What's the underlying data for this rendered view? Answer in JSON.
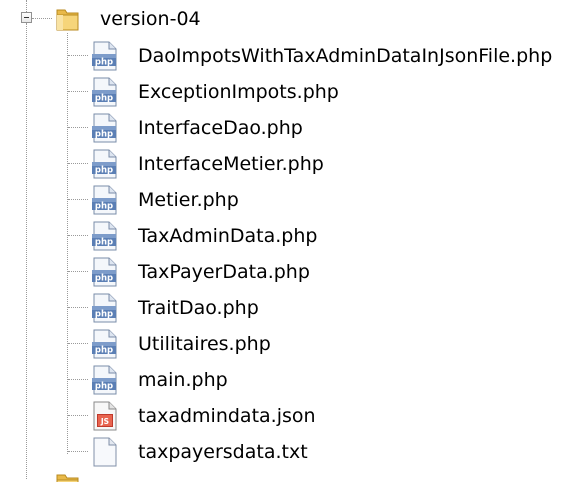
{
  "folder": {
    "name": "version-04",
    "icon": "folder-icon",
    "expanded": true
  },
  "files": [
    {
      "name": "DaoImpotsWithTaxAdminDataInJsonFile.php",
      "icon": "php-file-icon"
    },
    {
      "name": "ExceptionImpots.php",
      "icon": "php-file-icon"
    },
    {
      "name": "InterfaceDao.php",
      "icon": "php-file-icon"
    },
    {
      "name": "InterfaceMetier.php",
      "icon": "php-file-icon"
    },
    {
      "name": "Metier.php",
      "icon": "php-file-icon"
    },
    {
      "name": "TaxAdminData.php",
      "icon": "php-file-icon"
    },
    {
      "name": "TaxPayerData.php",
      "icon": "php-file-icon"
    },
    {
      "name": "TraitDao.php",
      "icon": "php-file-icon"
    },
    {
      "name": "Utilitaires.php",
      "icon": "php-file-icon"
    },
    {
      "name": "main.php",
      "icon": "php-file-icon"
    },
    {
      "name": "taxadmindata.json",
      "icon": "json-file-icon"
    },
    {
      "name": "taxpayersdata.txt",
      "icon": "text-file-icon"
    }
  ],
  "colors": {
    "php_icon_blue": "#4a6fa5",
    "folder_yellow": "#f2cf6b",
    "json_red": "#c0392b"
  }
}
